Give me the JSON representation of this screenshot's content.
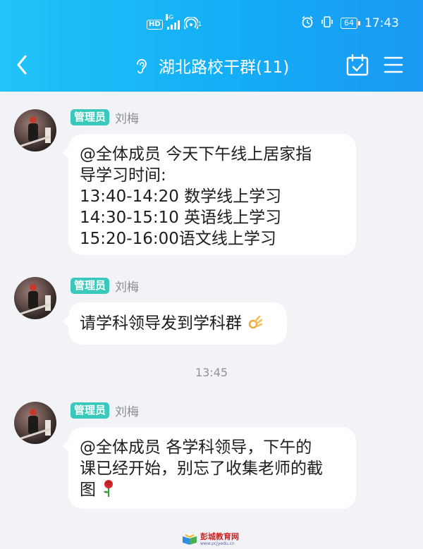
{
  "status_bar": {
    "hd": "HD",
    "network": "5G",
    "hotspot_count": "1",
    "battery": "64",
    "time": "17:43"
  },
  "nav": {
    "title": "湖北路校干群(11)",
    "icons": [
      "back-arrow-icon",
      "ear-icon",
      "calendar-check-icon",
      "menu-icon"
    ]
  },
  "messages": [
    {
      "role": "管理员",
      "sender": "刘梅",
      "lines": [
        "@全体成员 今天下午线上居家指",
        "导学习时间:",
        "13:40-14:20 数学线上学习",
        "14:30-15:10 英语线上学习",
        "15:20-16:00语文线上学习"
      ]
    },
    {
      "role": "管理员",
      "sender": "刘梅",
      "text": "请学科领导发到学科群",
      "emoji": "ok-hand-icon"
    },
    {
      "role": "管理员",
      "sender": "刘梅",
      "lines": [
        "@全体成员 各学科领导，下午的",
        "课已经开始，别忘了收集老师的截",
        "图"
      ],
      "emoji": "rose-icon"
    }
  ],
  "timestamp": "13:45",
  "watermark": {
    "title": "彭城教育网",
    "url": "www.pcjyedu.cn"
  },
  "colors": {
    "header_gradient": [
      "#21c4f8",
      "#1a98f3"
    ],
    "badge": "#39c9bc",
    "background": "#f2f3f7"
  }
}
